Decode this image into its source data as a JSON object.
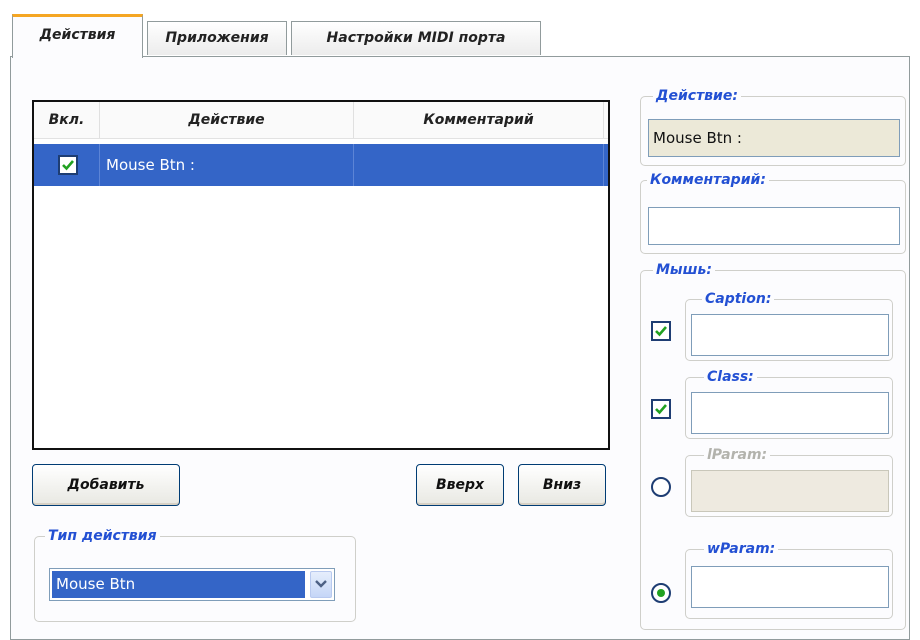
{
  "tabs": [
    {
      "label": "Действия",
      "active": true
    },
    {
      "label": "Приложения",
      "active": false
    },
    {
      "label": "Настройки MIDI порта",
      "active": false
    }
  ],
  "actions_list": {
    "columns": [
      "Вкл.",
      "Действие",
      "Комментарий"
    ],
    "rows": [
      {
        "enabled": true,
        "action": "Mouse Btn :",
        "comment": "",
        "selected": true
      }
    ]
  },
  "buttons": {
    "add": "Добавить",
    "up": "Вверх",
    "down": "Вниз"
  },
  "action_type": {
    "legend": "Тип действия",
    "value": "Mouse Btn"
  },
  "action_panel": {
    "legend": "Действие:",
    "value": "Mouse Btn :"
  },
  "comment_panel": {
    "legend": "Комментарий:",
    "value": ""
  },
  "mouse_panel": {
    "legend": "Мышь:",
    "caption": {
      "label": "Caption:",
      "value": "",
      "checked": true
    },
    "class": {
      "label": "Class:",
      "value": "",
      "checked": true
    },
    "lparam": {
      "label": "lParam:",
      "value": "",
      "selected": false,
      "enabled": false
    },
    "wparam": {
      "label": "wParam:",
      "value": "",
      "selected": true
    }
  },
  "colors": {
    "accent_blue": "#2350d3",
    "selection": "#3465c7",
    "active_tab_top": "#f5a623",
    "check_green": "#21a121"
  }
}
